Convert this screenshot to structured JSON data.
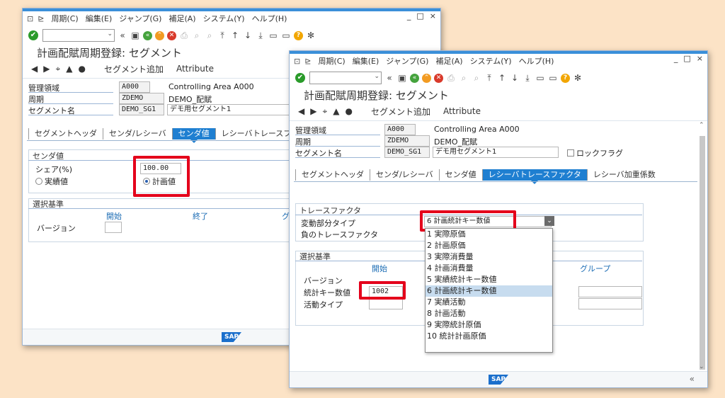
{
  "menu": {
    "system_icon": "⊡",
    "help_icon": "⊵",
    "items": [
      "周期(C)",
      "編集(E)",
      "ジャンプ(G)",
      "補足(A)",
      "システム(Y)",
      "ヘルプ(H)"
    ]
  },
  "window_controls": [
    "_",
    "□",
    "×"
  ],
  "toolbar": {
    "cmd_field_value": "",
    "icons": [
      "check-icon",
      "back-icon",
      "save-icon",
      "green-back-icon",
      "exit-icon",
      "cancel-icon",
      "print-icon",
      "find-icon",
      "find-next-icon",
      "first-page-icon",
      "prev-page-icon",
      "next-page-icon",
      "last-page-icon",
      "new-session-icon",
      "shortcut-icon",
      "help-icon",
      "settings-icon"
    ]
  },
  "window1": {
    "title": "計画配賦周期登録: セグメント",
    "app_toolbar": {
      "add_segment": "セグメント追加",
      "attribute": "Attribute"
    },
    "fields": {
      "controlling_area_label": "管理領域",
      "controlling_area_value": "A000",
      "controlling_area_text": "Controlling Area A000",
      "cycle_label": "周期",
      "cycle_value": "ZDEMO",
      "cycle_text": "DEMO_配賦",
      "segment_label": "セグメント名",
      "segment_value": "DEMO_SG1",
      "segment_text": "デモ用セグメント1"
    },
    "tabs": [
      "セグメントヘッダ",
      "センダ/レシーバ",
      "センダ値",
      "レシーバトレースファクタ"
    ],
    "active_tab": 2,
    "sender_group": {
      "header": "センダ値",
      "share_label": "シェア(%)",
      "share_value": "100.00",
      "radio_actual": "実績値",
      "radio_plan": "計画値"
    },
    "selection_group": {
      "header": "選択基準",
      "col_from": "開始",
      "col_to": "終了",
      "col_group": "グ",
      "version_label": "バージョン"
    }
  },
  "window2": {
    "title": "計画配賦周期登録: セグメント",
    "app_toolbar": {
      "add_segment": "セグメント追加",
      "attribute": "Attribute"
    },
    "fields": {
      "controlling_area_label": "管理領域",
      "controlling_area_value": "A000",
      "controlling_area_text": "Controlling Area A000",
      "cycle_label": "周期",
      "cycle_value": "ZDEMO",
      "cycle_text": "DEMO_配賦",
      "segment_label": "セグメント名",
      "segment_value": "DEMO_SG1",
      "segment_text": "デモ用セグメント1",
      "lock_flag_label": "ロックフラグ"
    },
    "tabs": [
      "セグメントヘッダ",
      "センダ/レシーバ",
      "センダ値",
      "レシーバトレースファクタ",
      "レシーバ加重係数"
    ],
    "active_tab": 3,
    "trace_group": {
      "header": "トレースファクタ",
      "var_type_label": "変動部分タイプ",
      "var_type_value": "6 計画統計キー数値",
      "neg_trace_label": "負のトレースファクタ"
    },
    "selection_group": {
      "header": "選択基準",
      "col_from": "開始",
      "col_group": "グループ",
      "version_label": "バージョン",
      "stat_key_label": "統計キー数値",
      "stat_key_value": "1002",
      "activity_type_label": "活動タイプ"
    },
    "dropdown_options": [
      "1 実際原価",
      "2 計画原価",
      "3 実際消費量",
      "4 計画消費量",
      "5 実績統計キー数値",
      "6 計画統計キー数値",
      "7 実績活動",
      "8 計画活動",
      "9 実際統計原価",
      "10 統計計画原価"
    ],
    "dropdown_selected": 5
  },
  "status_bar": {
    "logo": "SAP"
  },
  "colors": {
    "highlight": "#e4001b",
    "active_tab": "#1f7fd1",
    "title_bar": "#3a8fd9",
    "label_blue": "#1d6db5"
  }
}
